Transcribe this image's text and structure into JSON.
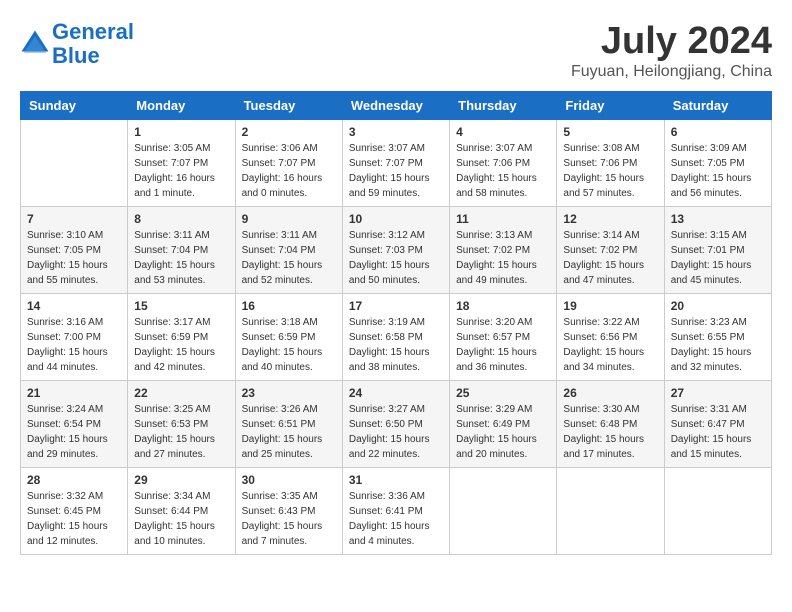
{
  "header": {
    "logo_line1": "General",
    "logo_line2": "Blue",
    "month": "July 2024",
    "location": "Fuyuan, Heilongjiang, China"
  },
  "columns": [
    "Sunday",
    "Monday",
    "Tuesday",
    "Wednesday",
    "Thursday",
    "Friday",
    "Saturday"
  ],
  "weeks": [
    [
      {
        "day": "",
        "data": ""
      },
      {
        "day": "1",
        "data": "Sunrise: 3:05 AM\nSunset: 7:07 PM\nDaylight: 16 hours\nand 1 minute."
      },
      {
        "day": "2",
        "data": "Sunrise: 3:06 AM\nSunset: 7:07 PM\nDaylight: 16 hours\nand 0 minutes."
      },
      {
        "day": "3",
        "data": "Sunrise: 3:07 AM\nSunset: 7:07 PM\nDaylight: 15 hours\nand 59 minutes."
      },
      {
        "day": "4",
        "data": "Sunrise: 3:07 AM\nSunset: 7:06 PM\nDaylight: 15 hours\nand 58 minutes."
      },
      {
        "day": "5",
        "data": "Sunrise: 3:08 AM\nSunset: 7:06 PM\nDaylight: 15 hours\nand 57 minutes."
      },
      {
        "day": "6",
        "data": "Sunrise: 3:09 AM\nSunset: 7:05 PM\nDaylight: 15 hours\nand 56 minutes."
      }
    ],
    [
      {
        "day": "7",
        "data": "Sunrise: 3:10 AM\nSunset: 7:05 PM\nDaylight: 15 hours\nand 55 minutes."
      },
      {
        "day": "8",
        "data": "Sunrise: 3:11 AM\nSunset: 7:04 PM\nDaylight: 15 hours\nand 53 minutes."
      },
      {
        "day": "9",
        "data": "Sunrise: 3:11 AM\nSunset: 7:04 PM\nDaylight: 15 hours\nand 52 minutes."
      },
      {
        "day": "10",
        "data": "Sunrise: 3:12 AM\nSunset: 7:03 PM\nDaylight: 15 hours\nand 50 minutes."
      },
      {
        "day": "11",
        "data": "Sunrise: 3:13 AM\nSunset: 7:02 PM\nDaylight: 15 hours\nand 49 minutes."
      },
      {
        "day": "12",
        "data": "Sunrise: 3:14 AM\nSunset: 7:02 PM\nDaylight: 15 hours\nand 47 minutes."
      },
      {
        "day": "13",
        "data": "Sunrise: 3:15 AM\nSunset: 7:01 PM\nDaylight: 15 hours\nand 45 minutes."
      }
    ],
    [
      {
        "day": "14",
        "data": "Sunrise: 3:16 AM\nSunset: 7:00 PM\nDaylight: 15 hours\nand 44 minutes."
      },
      {
        "day": "15",
        "data": "Sunrise: 3:17 AM\nSunset: 6:59 PM\nDaylight: 15 hours\nand 42 minutes."
      },
      {
        "day": "16",
        "data": "Sunrise: 3:18 AM\nSunset: 6:59 PM\nDaylight: 15 hours\nand 40 minutes."
      },
      {
        "day": "17",
        "data": "Sunrise: 3:19 AM\nSunset: 6:58 PM\nDaylight: 15 hours\nand 38 minutes."
      },
      {
        "day": "18",
        "data": "Sunrise: 3:20 AM\nSunset: 6:57 PM\nDaylight: 15 hours\nand 36 minutes."
      },
      {
        "day": "19",
        "data": "Sunrise: 3:22 AM\nSunset: 6:56 PM\nDaylight: 15 hours\nand 34 minutes."
      },
      {
        "day": "20",
        "data": "Sunrise: 3:23 AM\nSunset: 6:55 PM\nDaylight: 15 hours\nand 32 minutes."
      }
    ],
    [
      {
        "day": "21",
        "data": "Sunrise: 3:24 AM\nSunset: 6:54 PM\nDaylight: 15 hours\nand 29 minutes."
      },
      {
        "day": "22",
        "data": "Sunrise: 3:25 AM\nSunset: 6:53 PM\nDaylight: 15 hours\nand 27 minutes."
      },
      {
        "day": "23",
        "data": "Sunrise: 3:26 AM\nSunset: 6:51 PM\nDaylight: 15 hours\nand 25 minutes."
      },
      {
        "day": "24",
        "data": "Sunrise: 3:27 AM\nSunset: 6:50 PM\nDaylight: 15 hours\nand 22 minutes."
      },
      {
        "day": "25",
        "data": "Sunrise: 3:29 AM\nSunset: 6:49 PM\nDaylight: 15 hours\nand 20 minutes."
      },
      {
        "day": "26",
        "data": "Sunrise: 3:30 AM\nSunset: 6:48 PM\nDaylight: 15 hours\nand 17 minutes."
      },
      {
        "day": "27",
        "data": "Sunrise: 3:31 AM\nSunset: 6:47 PM\nDaylight: 15 hours\nand 15 minutes."
      }
    ],
    [
      {
        "day": "28",
        "data": "Sunrise: 3:32 AM\nSunset: 6:45 PM\nDaylight: 15 hours\nand 12 minutes."
      },
      {
        "day": "29",
        "data": "Sunrise: 3:34 AM\nSunset: 6:44 PM\nDaylight: 15 hours\nand 10 minutes."
      },
      {
        "day": "30",
        "data": "Sunrise: 3:35 AM\nSunset: 6:43 PM\nDaylight: 15 hours\nand 7 minutes."
      },
      {
        "day": "31",
        "data": "Sunrise: 3:36 AM\nSunset: 6:41 PM\nDaylight: 15 hours\nand 4 minutes."
      },
      {
        "day": "",
        "data": ""
      },
      {
        "day": "",
        "data": ""
      },
      {
        "day": "",
        "data": ""
      }
    ]
  ]
}
